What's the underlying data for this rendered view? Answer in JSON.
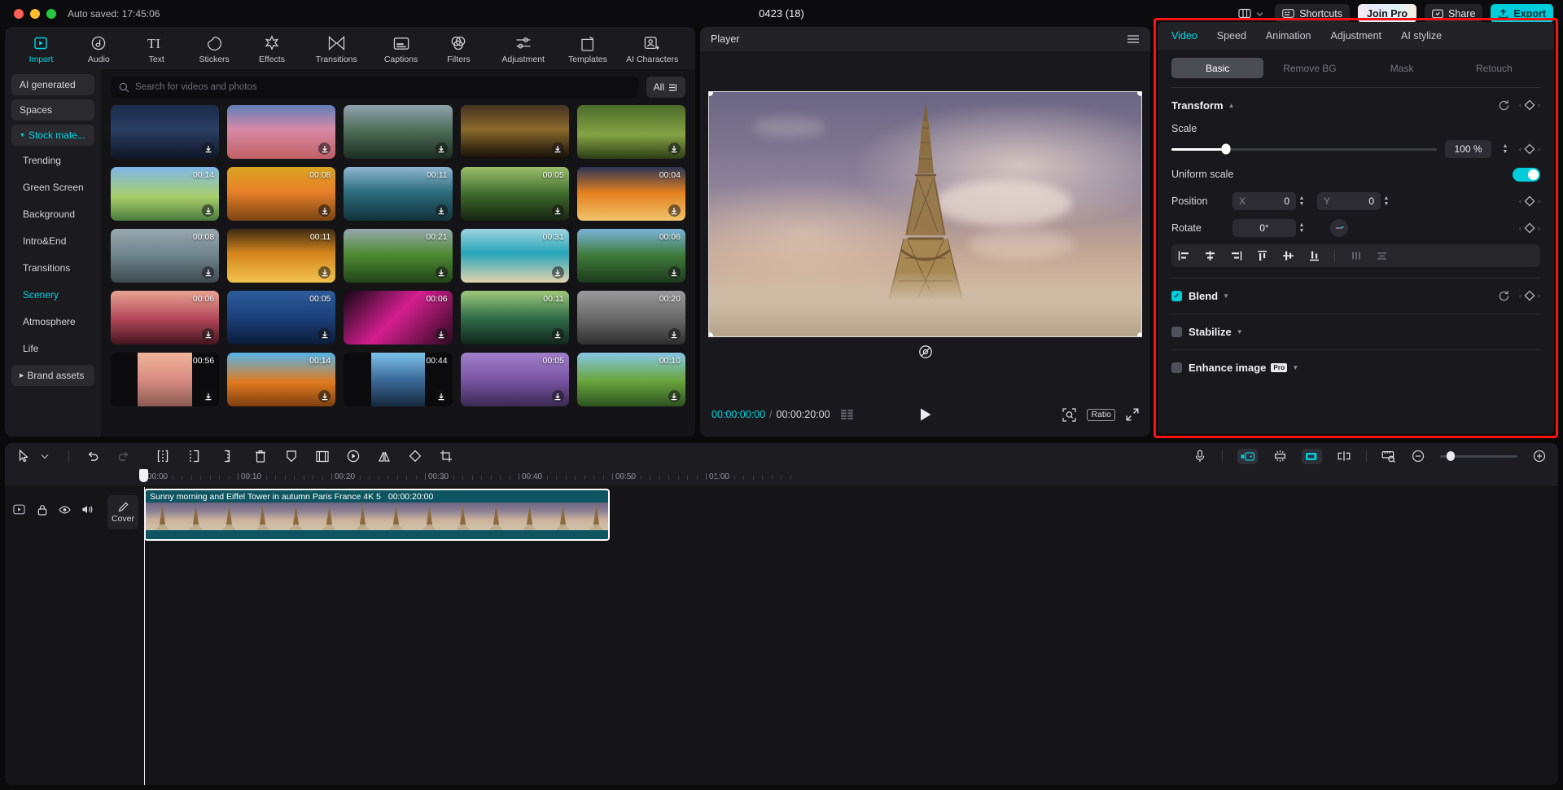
{
  "titlebar": {
    "autosaved": "Auto saved: 17:45:06",
    "project_title": "0423 (18)",
    "layout_icon": "layout-icon",
    "chevron": "chevron-down-icon",
    "shortcuts": "Shortcuts",
    "join_pro": "Join Pro",
    "share": "Share",
    "export": "Export"
  },
  "nav": {
    "items": [
      {
        "label": "Import",
        "icon": "import-icon",
        "active": true
      },
      {
        "label": "Audio",
        "icon": "audio-icon",
        "active": false
      },
      {
        "label": "Text",
        "icon": "text-icon",
        "active": false
      },
      {
        "label": "Stickers",
        "icon": "stickers-icon",
        "active": false
      },
      {
        "label": "Effects",
        "icon": "effects-icon",
        "active": false
      },
      {
        "label": "Transitions",
        "icon": "transitions-icon",
        "active": false
      },
      {
        "label": "Captions",
        "icon": "captions-icon",
        "active": false
      },
      {
        "label": "Filters",
        "icon": "filters-icon",
        "active": false
      },
      {
        "label": "Adjustment",
        "icon": "adjustment-icon",
        "active": false
      },
      {
        "label": "Templates",
        "icon": "templates-icon",
        "active": false
      },
      {
        "label": "AI Characters",
        "icon": "ai-characters-icon",
        "active": false
      }
    ]
  },
  "categories": [
    {
      "label": "AI generated",
      "type": "group",
      "active": false
    },
    {
      "label": "Spaces",
      "type": "group",
      "active": false
    },
    {
      "label": "Stock mate...",
      "type": "group",
      "active": true,
      "expanded": true
    },
    {
      "label": "Trending",
      "type": "sub",
      "active": false
    },
    {
      "label": "Green Screen",
      "type": "sub",
      "active": false
    },
    {
      "label": "Background",
      "type": "sub",
      "active": false
    },
    {
      "label": "Intro&End",
      "type": "sub",
      "active": false
    },
    {
      "label": "Transitions",
      "type": "sub",
      "active": false
    },
    {
      "label": "Scenery",
      "type": "sub",
      "active": true
    },
    {
      "label": "Atmosphere",
      "type": "sub",
      "active": false
    },
    {
      "label": "Life",
      "type": "sub",
      "active": false
    },
    {
      "label": "Brand assets",
      "type": "group",
      "active": false,
      "collapsed": true
    }
  ],
  "search": {
    "placeholder": "Search for videos and photos",
    "value": "",
    "icon": "search-icon",
    "filter_label": "All",
    "filter_icon": "filter-icon"
  },
  "media_tiles": [
    {
      "duration": "",
      "name": "city-night-aerial",
      "download_icon": "download-icon"
    },
    {
      "duration": "",
      "name": "city-skyline-sunset",
      "download_icon": "download-icon"
    },
    {
      "duration": "",
      "name": "mountain-lake",
      "download_icon": "download-icon"
    },
    {
      "duration": "",
      "name": "autumn-forest-dark",
      "download_icon": "download-icon"
    },
    {
      "duration": "",
      "name": "green-grass-field",
      "download_icon": "download-icon"
    },
    {
      "duration": "00:14",
      "name": "spring-buds-sky",
      "download_icon": "download-icon"
    },
    {
      "duration": "00:08",
      "name": "autumn-leaves-gold",
      "download_icon": "download-icon"
    },
    {
      "duration": "00:11",
      "name": "coastal-cliffs",
      "download_icon": "download-icon"
    },
    {
      "duration": "00:05",
      "name": "forest-sunbeams",
      "download_icon": "download-icon"
    },
    {
      "duration": "00:04",
      "name": "sunset-above-clouds",
      "download_icon": "download-icon"
    },
    {
      "duration": "00:08",
      "name": "statue-of-liberty",
      "download_icon": "download-icon"
    },
    {
      "duration": "00:11",
      "name": "desert-road-sunset",
      "download_icon": "download-icon"
    },
    {
      "duration": "00:21",
      "name": "alpine-meadow",
      "download_icon": "download-icon"
    },
    {
      "duration": "00:31",
      "name": "turquoise-beach",
      "download_icon": "download-icon"
    },
    {
      "duration": "00:06",
      "name": "river-valley-forest",
      "download_icon": "download-icon"
    },
    {
      "duration": "00:06",
      "name": "red-desert-butte",
      "download_icon": "download-icon"
    },
    {
      "duration": "00:05",
      "name": "blue-city-skyscrapers",
      "download_icon": "download-icon"
    },
    {
      "duration": "00:06",
      "name": "magenta-flower",
      "download_icon": "download-icon"
    },
    {
      "duration": "00:11",
      "name": "jungle-waterfall",
      "download_icon": "download-icon"
    },
    {
      "duration": "00:20",
      "name": "eiffel-tower-bw",
      "download_icon": "download-icon"
    },
    {
      "duration": "00:56",
      "name": "pink-beach-sunset",
      "download_icon": "download-icon"
    },
    {
      "duration": "00:14",
      "name": "autumn-canopy-sky",
      "download_icon": "download-icon"
    },
    {
      "duration": "00:44",
      "name": "mirror-lake-mountain",
      "download_icon": "download-icon"
    },
    {
      "duration": "00:05",
      "name": "lavender-field",
      "download_icon": "download-icon"
    },
    {
      "duration": "00:10",
      "name": "green-hillside",
      "download_icon": "download-icon"
    }
  ],
  "player": {
    "title": "Player",
    "menu_icon": "hamburger-menu-icon",
    "reset_icon": "reset-transform-icon",
    "current_time": "00:00:00:00",
    "separator": "/",
    "total_time": "00:00:20:00",
    "frames_icon": "frames-icon",
    "play_icon": "play-icon",
    "zoom_icon": "zoom-fit-icon",
    "ratio_label": "Ratio",
    "fullscreen_icon": "fullscreen-icon"
  },
  "inspector": {
    "tabs": [
      {
        "label": "Video",
        "active": true
      },
      {
        "label": "Speed",
        "active": false
      },
      {
        "label": "Animation",
        "active": false
      },
      {
        "label": "Adjustment",
        "active": false
      },
      {
        "label": "AI stylize",
        "active": false
      }
    ],
    "segments": [
      {
        "label": "Basic",
        "active": true
      },
      {
        "label": "Remove BG",
        "active": false
      },
      {
        "label": "Mask",
        "active": false
      },
      {
        "label": "Retouch",
        "active": false
      }
    ],
    "transform": {
      "title": "Transform",
      "reset_icon": "reset-icon",
      "keyframe_icon": "keyframe-diamond-icon",
      "scale_label": "Scale",
      "scale_value": "100 %",
      "scale_percent": 20.5,
      "uniform_scale_label": "Uniform scale",
      "uniform_scale_on": true,
      "position_label": "Position",
      "position_x_axis": "X",
      "position_x": "0",
      "position_y_axis": "Y",
      "position_y": "0",
      "rotate_label": "Rotate",
      "rotate_value": "0°",
      "rotate_dial_icon": "rotate-dial-icon",
      "align_icons": [
        "align-left-icon",
        "align-center-horizontal-icon",
        "align-right-icon",
        "align-top-icon",
        "align-middle-vertical-icon",
        "align-bottom-icon",
        "distribute-horizontal-icon",
        "distribute-vertical-icon"
      ]
    },
    "blend": {
      "label": "Blend",
      "checked": true,
      "reset_icon": "reset-icon",
      "keyframe_icon": "keyframe-diamond-icon"
    },
    "stabilize": {
      "label": "Stabilize",
      "checked": false
    },
    "enhance": {
      "label": "Enhance image",
      "badge": "Pro",
      "checked": false
    }
  },
  "timeline": {
    "tools": [
      "select-cursor-icon",
      "tool-dropdown-chevron-icon",
      "undo-icon",
      "redo-icon",
      "split-icon",
      "trim-left-icon",
      "trim-right-icon",
      "delete-icon",
      "mask-shield-icon",
      "crop-frame-icon",
      "keyframe-playback-icon",
      "mirror-icon",
      "rotate-square-icon",
      "crop-icon"
    ],
    "right_tools": [
      "microphone-icon",
      "snap-left-icon",
      "auto-fit-icon",
      "snap-right-icon",
      "link-toggle-icon",
      "measure-icon",
      "zoom-out-icon",
      "zoom-in-icon"
    ],
    "zoom_value": 14,
    "ruler_labels": [
      "00:00",
      "00:10",
      "00:20",
      "00:30",
      "00:40",
      "00:50",
      "01:00"
    ],
    "track_header_icons": [
      "track-type-icon",
      "lock-icon",
      "eye-icon",
      "speaker-icon"
    ],
    "cover_label": "Cover",
    "cover_icon": "pen-icon",
    "clip": {
      "name": "Sunny morning and Eiffel Tower in autumn Paris France 4K 5",
      "duration": "00:00:20:00"
    }
  }
}
